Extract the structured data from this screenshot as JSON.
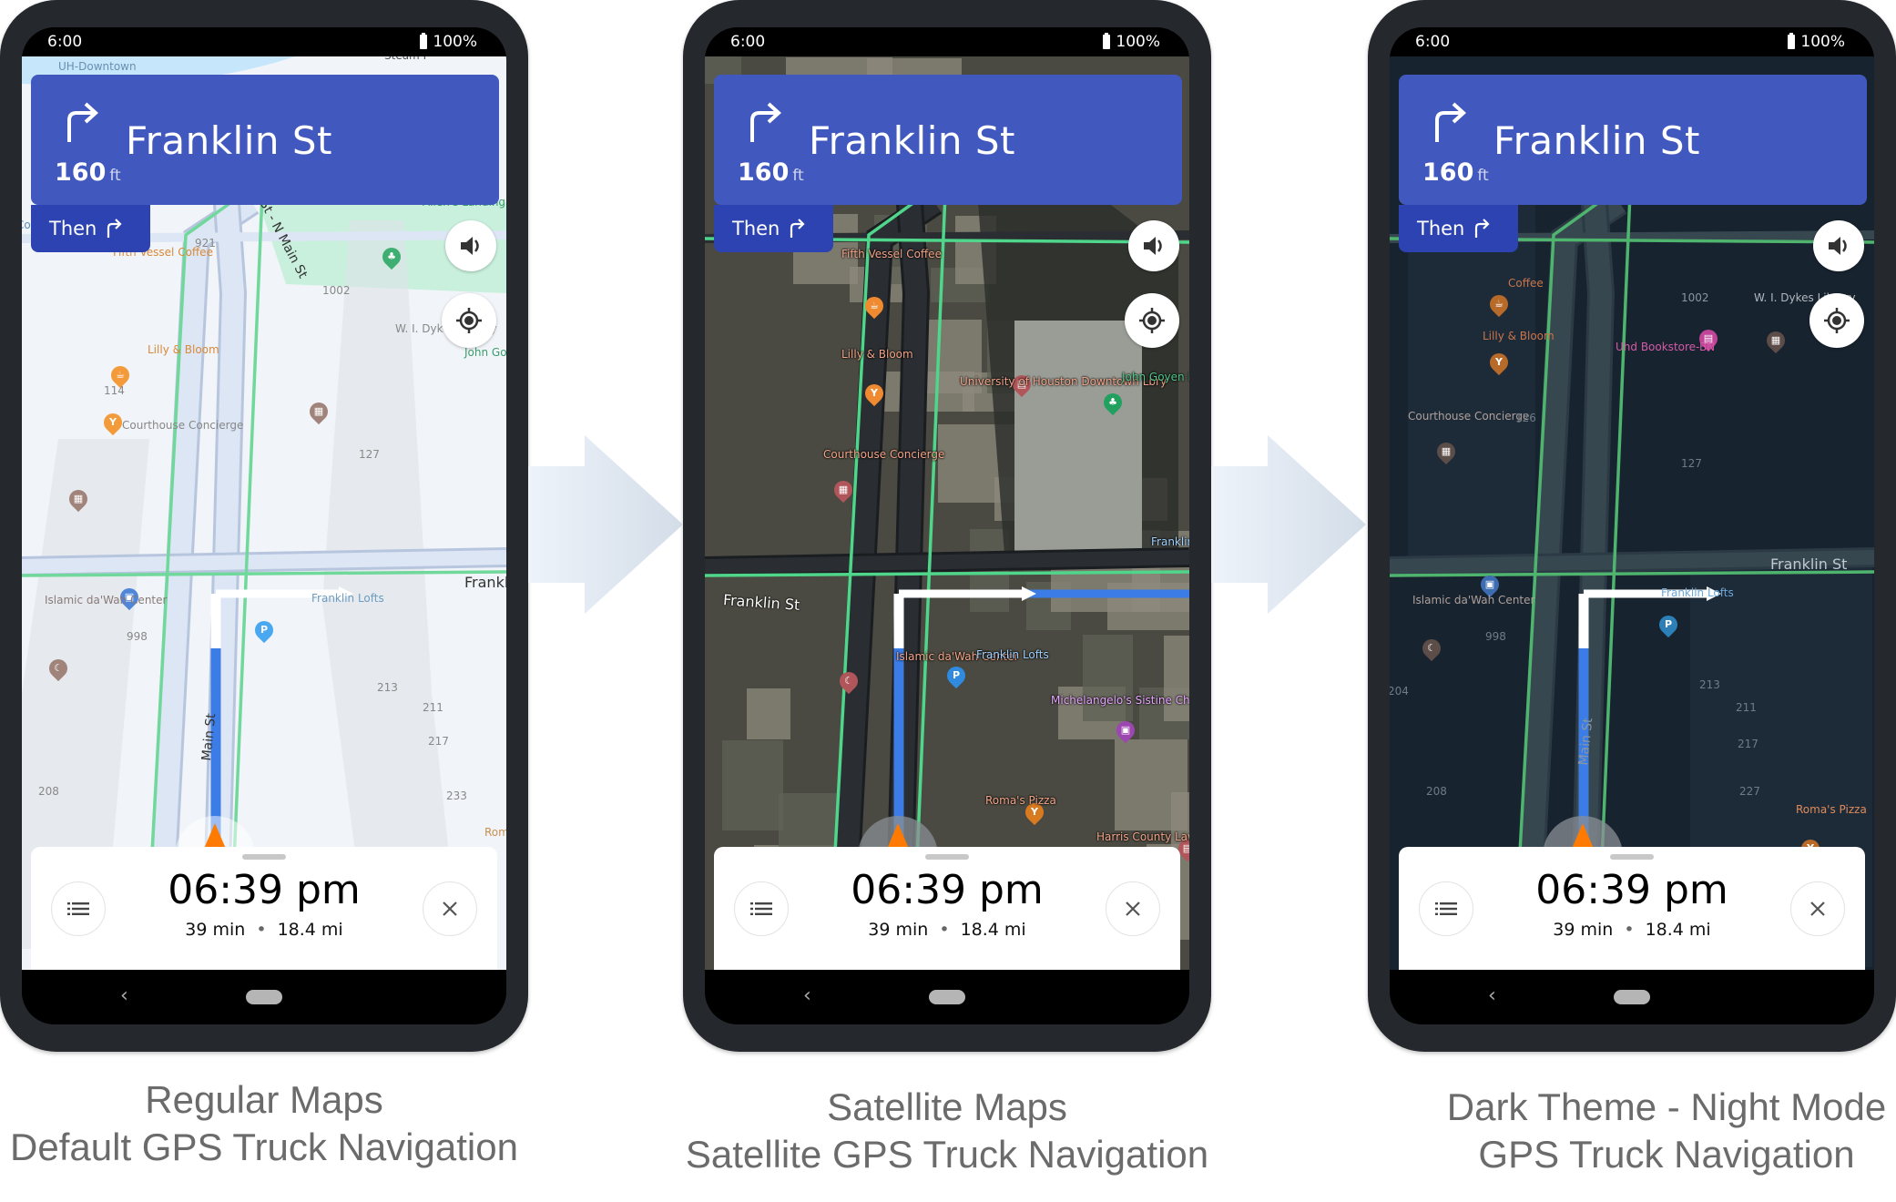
{
  "status_bar": {
    "time": "6:00",
    "battery": "100%"
  },
  "maneuver": {
    "street": "Franklin St",
    "distance": "160",
    "distance_unit": "ft",
    "then_label": "Then",
    "icon": "turn-right-icon"
  },
  "trip": {
    "eta": "06:39 pm",
    "duration": "39 min",
    "separator": "•",
    "distance": "18.4 mi"
  },
  "buttons": {
    "volume": "volume-icon",
    "recenter": "locate-icon",
    "route_list": "list-icon",
    "close": "close-icon"
  },
  "colors": {
    "maneuver_bg": "#4158bf",
    "then_bg": "#2c43b1",
    "route_blue": "#3b7ce6",
    "traffic_green": "#5fd38a",
    "nav_arrow": "#ff7a00"
  },
  "phones": [
    {
      "theme": "regular",
      "caption": [
        "Regular Maps",
        "Default GPS Truck Navigation"
      ],
      "map_labels": [
        "UH-Downtown",
        "Steam F",
        "Commerce",
        "921",
        "Fifth Vessel Coffee",
        "Allen's Landing",
        "N Main St - N Main St",
        "1002",
        "W. I. Dykes Library",
        "John Goyen P",
        "Lilly & Bloom",
        "114",
        "Courthouse Concierge",
        "127",
        "Franklin",
        "Franklin Lofts",
        "Islamic da'Wah Center",
        "998",
        "213",
        "211",
        "217",
        "Main St",
        "208",
        "233",
        "Roma Pizz"
      ]
    },
    {
      "theme": "satellite",
      "caption": [
        "Satellite Maps",
        "Satellite GPS Truck Navigation"
      ],
      "map_labels": [
        "Fifth Vessel Coffee",
        "Lilly & Bloom",
        "University of Houston Downtown Lbry",
        "John Goyen Park",
        "Courthouse Concierge",
        "Franklin St",
        "Franklin",
        "Islamic da'Wah Center",
        "Franklin Lofts",
        "Michelangelo's Sistine Chapel - the Exhibition",
        "Roma's Pizza",
        "Harris County Law Library"
      ]
    },
    {
      "theme": "dark",
      "caption": [
        "Dark Theme - Night Mode",
        "GPS Truck Navigation"
      ],
      "map_labels": [
        "Coffee",
        "1002",
        "W. I. Dykes Library",
        "Uhd Bookstore-BN",
        "Lilly & Bloom",
        "Courthouse Concierge",
        "126",
        "127",
        "Franklin St",
        "Islamic da'Wah Center",
        "998",
        "Franklin Lofts",
        "204",
        "213",
        "211",
        "217",
        "Main St",
        "208",
        "227",
        "Roma's Pizza"
      ]
    }
  ]
}
